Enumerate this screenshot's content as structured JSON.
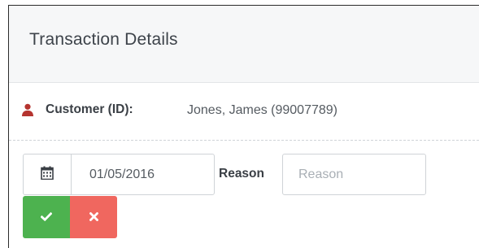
{
  "panel": {
    "title": "Transaction Details"
  },
  "customer": {
    "label": "Customer (ID):",
    "value": "Jones, James (99007789)",
    "icon": "person-icon",
    "icon_color": "#b5342f"
  },
  "form": {
    "date_value": "01/05/2016",
    "date_icon": "calendar-icon",
    "reason_label": "Reason",
    "reason_placeholder": "Reason",
    "reason_value": ""
  },
  "actions": {
    "confirm_icon": "check-icon",
    "cancel_icon": "close-icon",
    "confirm_color": "#4db24f",
    "cancel_color": "#f0675f"
  }
}
